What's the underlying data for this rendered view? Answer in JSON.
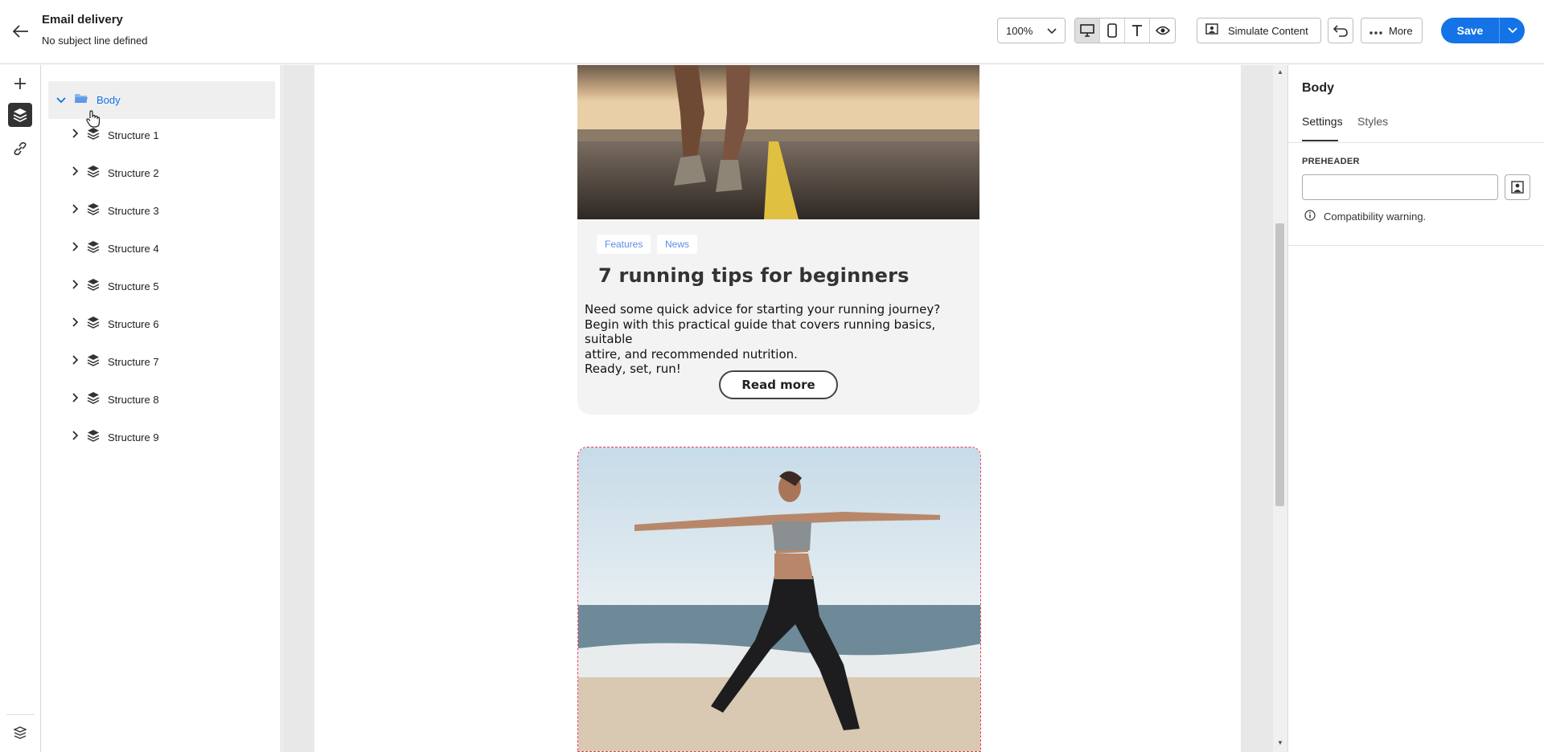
{
  "header": {
    "title": "Email delivery",
    "subtitle": "No subject line defined",
    "zoom": "100%",
    "simulate_label": "Simulate Content",
    "more_label": "More",
    "save_label": "Save"
  },
  "layers": {
    "body_label": "Body",
    "items": [
      {
        "label": "Structure 1"
      },
      {
        "label": "Structure 2"
      },
      {
        "label": "Structure 3"
      },
      {
        "label": "Structure 4"
      },
      {
        "label": "Structure 5"
      },
      {
        "label": "Structure 6"
      },
      {
        "label": "Structure 7"
      },
      {
        "label": "Structure 8"
      },
      {
        "label": "Structure 9"
      }
    ]
  },
  "content": {
    "tags": [
      "Features",
      "News"
    ],
    "article_title": "7 running tips for beginners",
    "article_lines": [
      "Need some quick advice for starting your running journey?",
      "Begin with this practical guide that covers running basics, suitable",
      "attire, and recommended nutrition.",
      "Ready, set, run!"
    ],
    "button_label": "Read more"
  },
  "properties": {
    "title": "Body",
    "tabs": [
      "Settings",
      "Styles"
    ],
    "active_tab": "Settings",
    "preheader_label": "PREHEADER",
    "preheader_value": "",
    "warning_text": "Compatibility warning."
  },
  "colors": {
    "accent": "#1473e6",
    "tag_text": "#5a8de8",
    "selection_dashed": "#e0405a"
  }
}
